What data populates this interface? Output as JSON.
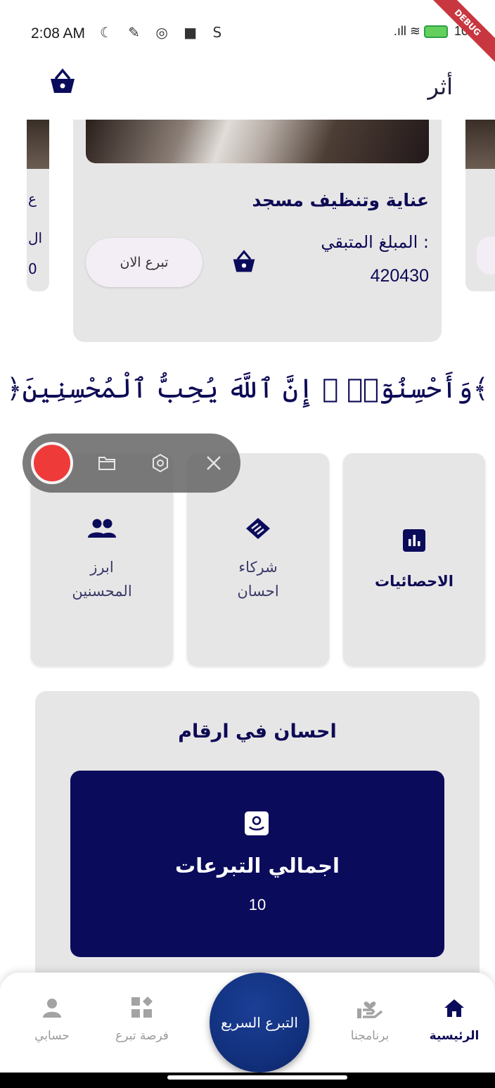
{
  "status_bar": {
    "time": "2:08 AM",
    "left_icons": "☾ ✎ ◎ ■ S",
    "signal_wifi": ".ıll ≋",
    "battery_percent": "100",
    "debug_label": "DEBUG"
  },
  "app_bar": {
    "logo_text": "أثر"
  },
  "carousel": {
    "main_card": {
      "title": "عناية وتنظيف مسجد",
      "remaining_label": "المبلغ المتبقي :",
      "remaining_value": "420430",
      "donate_now_label": "تبرع الان"
    },
    "left_card_fragments": [
      "ع",
      "ال",
      "0"
    ]
  },
  "verse": "﴿وَأَحْسِنُوٓا۟ ۛ إِنَّ ٱللَّهَ يُحِبُّ ٱلْمُحْسِنِينَ﴾",
  "tiles": [
    {
      "label_line1": "ابرز",
      "label_line2": "المحسنين",
      "icon": "group-icon"
    },
    {
      "label_line1": "شركاء",
      "label_line2": "احسان",
      "icon": "handshake-icon"
    },
    {
      "label_line1": "الاحصائيات",
      "label_line2": "",
      "icon": "bar-chart-icon"
    }
  ],
  "stats": {
    "title": "احسان في ارقام",
    "card_label": "اجمالي التبرعات",
    "card_value": "10",
    "card_icon": "volunteer-icon"
  },
  "bottom_nav": {
    "items": [
      {
        "label": "حسابي",
        "icon": "person-icon"
      },
      {
        "label": "فرصة تبرع",
        "icon": "dashboard-icon"
      },
      {
        "label": "برنامجنا",
        "icon": "hand-heart-icon"
      },
      {
        "label": "الرئيسية",
        "icon": "home-icon"
      }
    ],
    "fab_label": "التبرع السريع"
  },
  "colors": {
    "primary": "#0b0b5c",
    "card_bg": "#e7e6e6",
    "fab": "#12317e",
    "record": "#ef3a3a"
  }
}
